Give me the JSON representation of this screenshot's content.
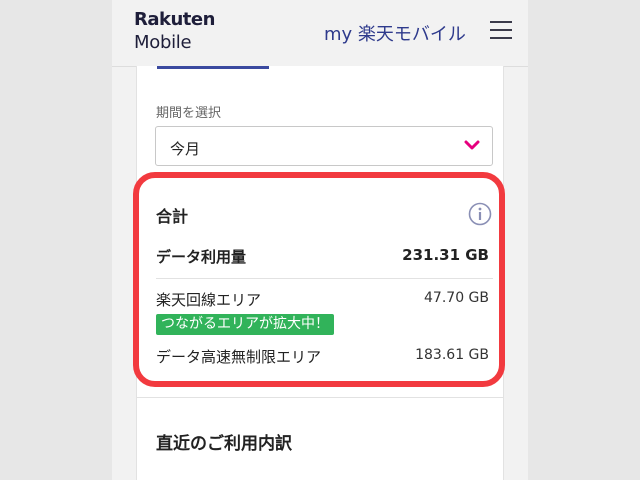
{
  "header": {
    "logo_line1": "Rakuten",
    "logo_line2": "Mobile",
    "my_link": "my 楽天モバイル",
    "menu_icon": "hamburger-menu-icon"
  },
  "period": {
    "label": "期間を選択",
    "selected": "今月",
    "chevron_icon": "chevron-down-icon"
  },
  "summary": {
    "title": "合計",
    "info_icon": "info-icon",
    "data_usage_label": "データ利用量",
    "data_usage_value": "231.31 GB",
    "rows": [
      {
        "label": "楽天回線エリア",
        "value": "47.70 GB",
        "badge": "つながるエリアが拡大中！"
      },
      {
        "label": "データ高速無制限エリア",
        "value": "183.61 GB"
      }
    ]
  },
  "recent": {
    "title": "直近のご利用内訳"
  },
  "colors": {
    "brand_navy": "#2e3a8c",
    "accent_pink": "#e6007e",
    "badge_green": "#31b35a",
    "highlight_red": "#f23a3f"
  }
}
